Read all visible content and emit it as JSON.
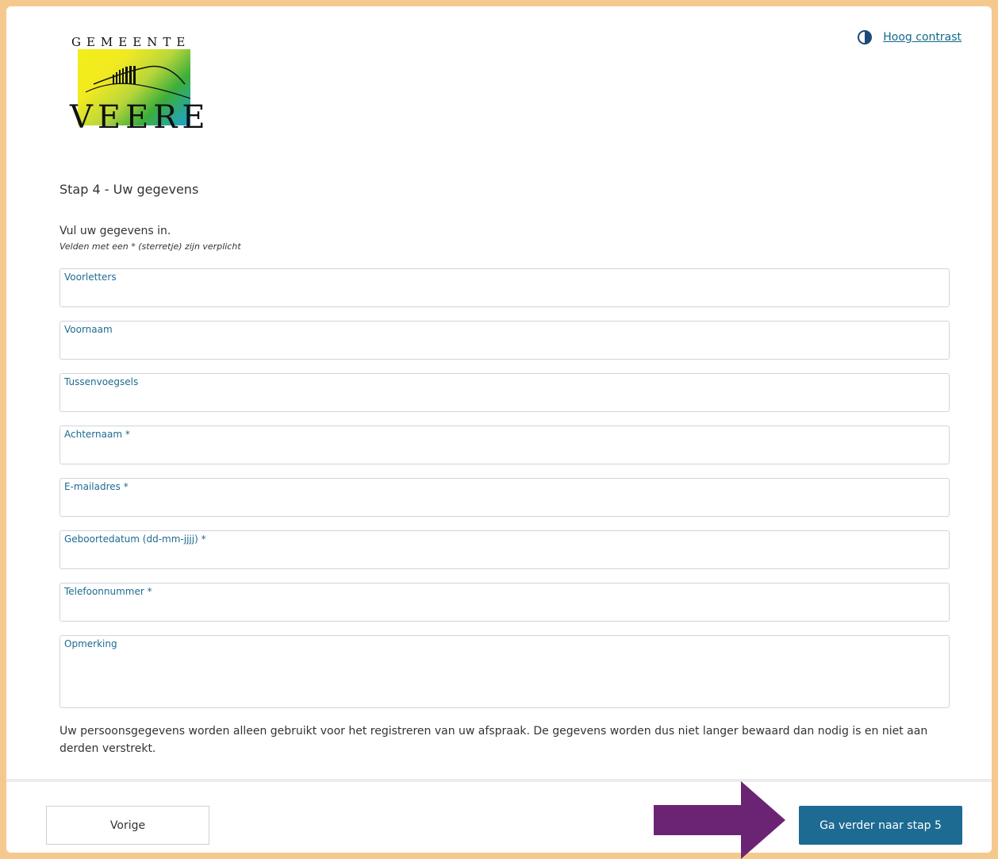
{
  "logo": {
    "top_text": "GEMEENTE",
    "bottom_text": "VEERE"
  },
  "header": {
    "contrast_link": "Hoog contrast"
  },
  "step": {
    "title": "Stap 4 - Uw gegevens",
    "intro": "Vul uw gegevens in.",
    "required_note": "Velden met een * (sterretje) zijn verplicht"
  },
  "fields": [
    {
      "label": "Voorletters",
      "value": ""
    },
    {
      "label": "Voornaam",
      "value": ""
    },
    {
      "label": "Tussenvoegsels",
      "value": ""
    },
    {
      "label": "Achternaam *",
      "value": ""
    },
    {
      "label": "E-mailadres *",
      "value": ""
    },
    {
      "label": "Geboortedatum (dd-mm-jjjj) *",
      "value": ""
    },
    {
      "label": "Telefoonnummer *",
      "value": ""
    },
    {
      "label": "Opmerking",
      "value": ""
    }
  ],
  "privacy_text": "Uw persoonsgegevens worden alleen gebruikt voor het registreren van uw afspraak. De gegevens worden dus niet langer bewaard dan nodig is en niet aan derden verstrekt.",
  "footer": {
    "back_label": "Vorige",
    "next_label": "Ga verder naar stap 5"
  },
  "colors": {
    "frame": "#f5c98e",
    "accent": "#1d6a92",
    "arrow": "#6b2473"
  },
  "icons": {
    "contrast": "half-circle-contrast-icon",
    "arrow": "arrow-right-icon"
  }
}
